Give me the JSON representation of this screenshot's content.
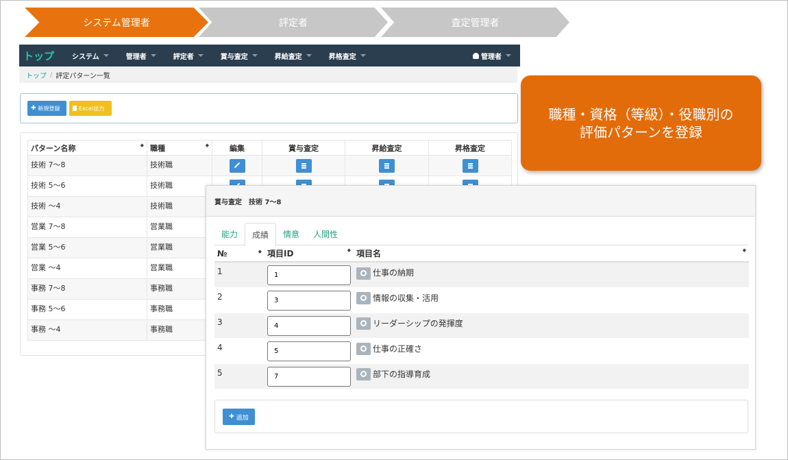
{
  "steps": [
    "システム管理者",
    "評定者",
    "査定管理者"
  ],
  "navbar": {
    "brand": "トップ",
    "items": [
      "システム",
      "管理者",
      "評定者",
      "賞与査定",
      "昇給査定",
      "昇格査定"
    ],
    "user": "管理者"
  },
  "breadcrumb": {
    "home": "トップ",
    "sep": "/",
    "current": "評定パターン一覧"
  },
  "buttons": {
    "new": "新規登録",
    "excel": "Excel出力"
  },
  "pattern_table": {
    "headers": [
      "パターン名称",
      "職種",
      "編集",
      "賞与査定",
      "昇給査定",
      "昇格査定"
    ],
    "rows": [
      [
        "技術 7～8",
        "技術職"
      ],
      [
        "技術 5～6",
        "技術職"
      ],
      [
        "技術 ～4",
        "技術職"
      ],
      [
        "営業 7～8",
        "営業職"
      ],
      [
        "営業 5～6",
        "営業職"
      ],
      [
        "営業 ～4",
        "営業職"
      ],
      [
        "事務 7～8",
        "事務職"
      ],
      [
        "事務 5～6",
        "事務職"
      ],
      [
        "事務 ～4",
        "事務職"
      ]
    ]
  },
  "callout": {
    "line1": "職種・資格（等級）・役職別の",
    "line2": "評価パターンを登録"
  },
  "modal": {
    "title": "賞与査定　技術 7～8",
    "tabs": [
      "能力",
      "成績",
      "情意",
      "人間性"
    ],
    "active_tab": "成績",
    "headers": [
      "№",
      "項目ID",
      "項目名"
    ],
    "rows": [
      {
        "no": "1",
        "id": "1",
        "name": "仕事の納期"
      },
      {
        "no": "2",
        "id": "3",
        "name": "情報の収集・活用"
      },
      {
        "no": "3",
        "id": "4",
        "name": "リーダーシップの発揮度"
      },
      {
        "no": "4",
        "id": "5",
        "name": "仕事の正確さ"
      },
      {
        "no": "5",
        "id": "7",
        "name": "部下の指導育成"
      }
    ],
    "add_label": "追加"
  },
  "colors": {
    "accent": "#e8730e",
    "navbar": "#2b3e50",
    "primary": "#3f8fd2",
    "brand": "#27c4a1"
  }
}
